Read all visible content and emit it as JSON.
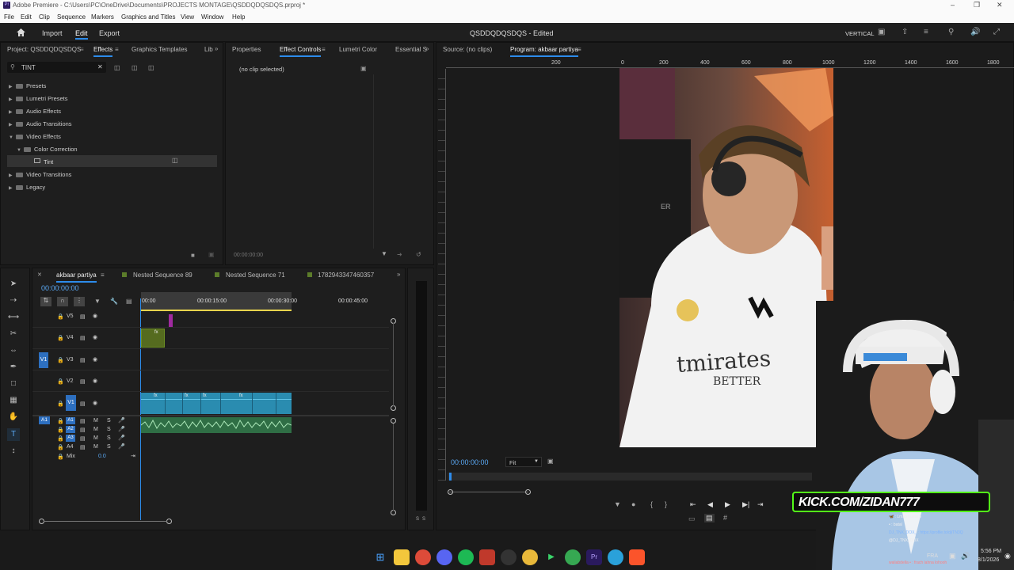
{
  "window": {
    "title": "Adobe Premiere - C:\\Users\\PC\\OneDrive\\Documents\\PROJECTS MONTAGE\\QSDDQDQSDQS.prproj *",
    "app_badge": "Pr"
  },
  "menu": [
    "File",
    "Edit",
    "Clip",
    "Sequence",
    "Markers",
    "Graphics and Titles",
    "View",
    "Window",
    "Help"
  ],
  "header": {
    "home_icon": "home-icon",
    "nav": [
      "Import",
      "Edit",
      "Export"
    ],
    "active_nav": "Edit",
    "project_title": "QSDDQDQSDQS - Edited",
    "workspace": "VERTICAL"
  },
  "effects_panel": {
    "tabs": [
      "Project: QSDDQDQSDQS",
      "Effects",
      "Graphics Templates",
      "Lib"
    ],
    "active_tab": "Effects",
    "search_value": "TINT",
    "tree": [
      "Presets",
      "Lumetri Presets",
      "Audio Effects",
      "Audio Transitions",
      "Video Effects",
      "Color Correction",
      "Tint",
      "Video Transitions",
      "Legacy"
    ]
  },
  "effect_controls": {
    "tabs": [
      "Properties",
      "Effect Controls",
      "Lumetri Color",
      "Essential S"
    ],
    "active_tab": "Effect Controls",
    "no_clip": "(no clip selected)",
    "timecode": "00:00:00:00"
  },
  "monitor": {
    "tabs": [
      "Source: (no clips)",
      "Program: akbaar partiya"
    ],
    "active_tab": "Program: akbaar partiya",
    "ruler": [
      "0",
      "200",
      "400",
      "600",
      "800",
      "1000",
      "1200",
      "1400",
      "1600",
      "1800"
    ],
    "ruler_neg": [
      "200",
      "0"
    ],
    "timecode": "00:00:00:00",
    "fit": "Fit",
    "jersey_text": "tmirates",
    "jersey_sub": "BETTER",
    "brand_text": "ER"
  },
  "timeline": {
    "tabs": [
      "akbaar partiya",
      "Nested Sequence 89",
      "Nested Sequence 71",
      "1782943347460357"
    ],
    "active_tab": "akbaar partiya",
    "timecode": "00:00:00:00",
    "ruler": [
      "00:00",
      "00:00:15:00",
      "00:00:30:00",
      "00:00:45:00"
    ],
    "video_tracks": [
      "V5",
      "V4",
      "V3",
      "V2",
      "V1"
    ],
    "source_patch_v": "V1",
    "audio_tracks": [
      "A1",
      "A2",
      "A3",
      "A4"
    ],
    "source_patch_a": "A1",
    "mix_label": "Mix",
    "mix_value": "0.0",
    "fx_badge": "fx",
    "audio_buttons": [
      "M",
      "S"
    ],
    "meter_labels": [
      "S",
      "S"
    ]
  },
  "stream": {
    "kick_text": "KICK.COM/ZIDAN777",
    "chat": [
      "🦋 : Lmao huma 5",
      "• : batal",
      "DJ_TNX_DOX_ : https://profile.to/dj/TN3Q",
      "@DJ_TNX_DOX",
      "waliabdella • : frach lahna lohooh"
    ]
  },
  "taskbar": {
    "lang": "FRA",
    "time": "5:56 PM",
    "date": "8/1/2026",
    "apps": [
      "windows-icon",
      "file-explorer-icon",
      "chrome-icon",
      "discord-icon",
      "spotify-icon",
      "app-red-icon",
      "github-icon",
      "chrome-icon-2",
      "play-icon",
      "chrome-icon-3",
      "premiere-icon",
      "telegram-icon",
      "brave-icon"
    ]
  },
  "colors": {
    "accent": "#2d8ceb",
    "video_clip": "#2a8cb0",
    "audio_clip": "#2f6e45",
    "nested_clip": "#6b8e23",
    "kick_green": "#53fc18"
  }
}
